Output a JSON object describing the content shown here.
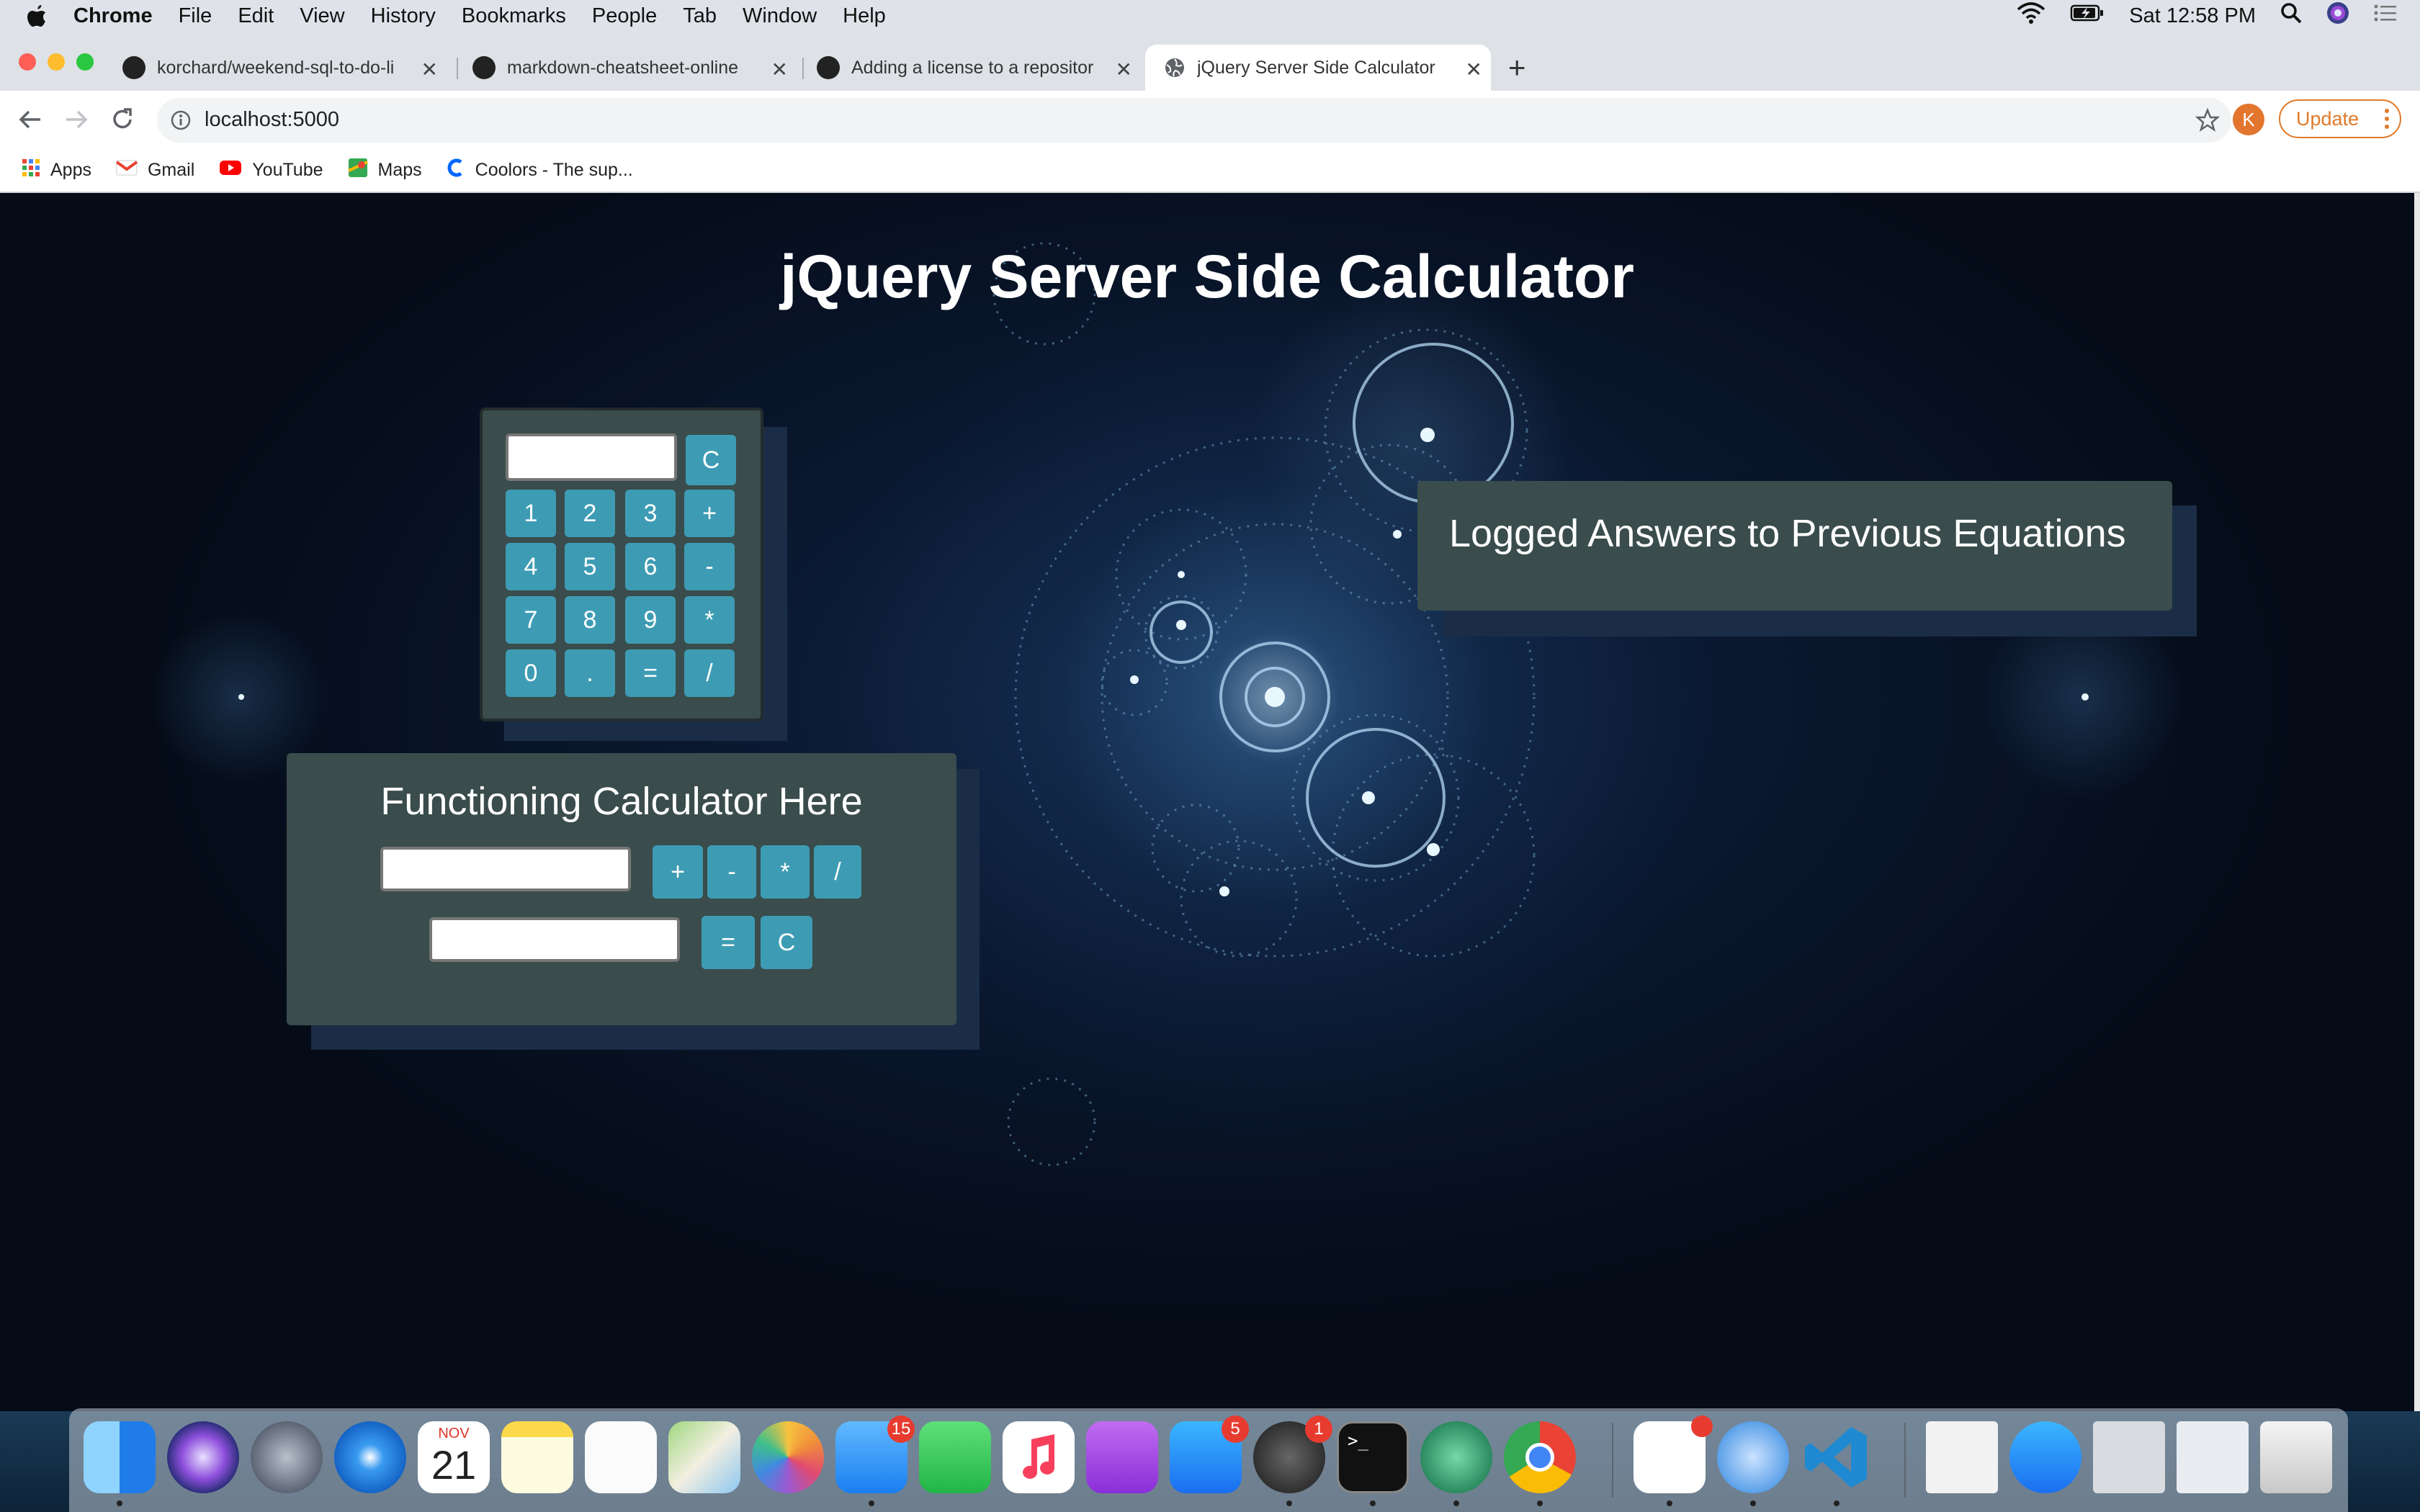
{
  "menubar": {
    "app_name": "Chrome",
    "items": [
      "File",
      "Edit",
      "View",
      "History",
      "Bookmarks",
      "People",
      "Tab",
      "Window",
      "Help"
    ],
    "clock": "Sat 12:58 PM"
  },
  "tabs": [
    {
      "title": "korchard/weekend-sql-to-do-li",
      "icon": "github-icon"
    },
    {
      "title": "markdown-cheatsheet-online",
      "icon": "github-icon"
    },
    {
      "title": "Adding a license to a repositor",
      "icon": "github-icon"
    },
    {
      "title": "jQuery Server Side Calculator",
      "icon": "globe-icon",
      "active": true
    }
  ],
  "address_bar": {
    "url": "localhost:5000"
  },
  "profile": {
    "initial": "K"
  },
  "update_button": "Update",
  "bookmarks": [
    "Apps",
    "Gmail",
    "YouTube",
    "Maps",
    "Coolors - The sup..."
  ],
  "page": {
    "title": "jQuery Server Side Calculator",
    "keypad": {
      "clear": "C",
      "rows": [
        [
          "1",
          "2",
          "3",
          "+"
        ],
        [
          "4",
          "5",
          "6",
          "-"
        ],
        [
          "7",
          "8",
          "9",
          "*"
        ],
        [
          "0",
          ".",
          "=",
          "/"
        ]
      ]
    },
    "functioning": {
      "title": "Functioning Calculator Here",
      "operators": [
        "+",
        "-",
        "*",
        "/"
      ],
      "equals": "=",
      "clear": "C"
    },
    "log": {
      "title": "Logged Answers to Previous Equations"
    }
  },
  "dock": {
    "calendar": {
      "month": "NOV",
      "day": "21"
    },
    "badges": {
      "messages": "15",
      "app_store": "5",
      "system_preferences": "1"
    }
  },
  "colors": {
    "panel": "#3a4c4c",
    "button": "#3d9cb4",
    "update": "#e07a2a",
    "avatar": "#e2762e"
  }
}
